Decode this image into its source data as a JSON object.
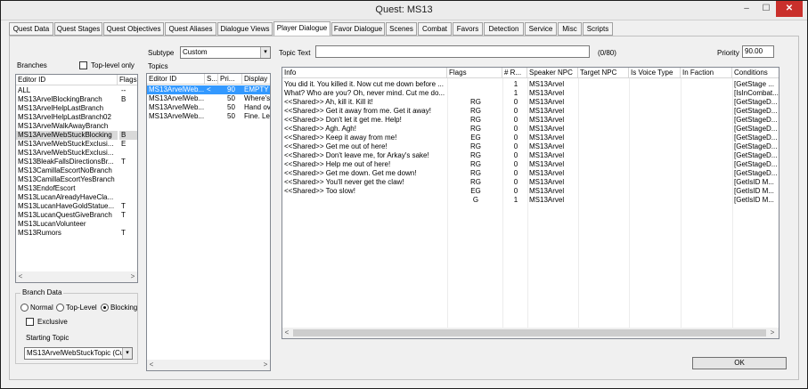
{
  "window": {
    "title": "Quest: MS13",
    "minimize": "–",
    "maximize": "☐",
    "close": "✕"
  },
  "tabs": [
    {
      "label": "Quest Data"
    },
    {
      "label": "Quest Stages"
    },
    {
      "label": "Quest Objectives"
    },
    {
      "label": "Quest Aliases"
    },
    {
      "label": "Dialogue Views"
    },
    {
      "label": "Player Dialogue"
    },
    {
      "label": "Favor Dialogue"
    },
    {
      "label": "Scenes"
    },
    {
      "label": "Combat"
    },
    {
      "label": "Favors"
    },
    {
      "label": "Detection"
    },
    {
      "label": "Service"
    },
    {
      "label": "Misc"
    },
    {
      "label": "Scripts"
    }
  ],
  "active_tab": "Player Dialogue",
  "branches": {
    "label": "Branches",
    "top_level_only_label": "Top-level only",
    "columns": [
      "Editor ID",
      "Flags"
    ],
    "rows": [
      {
        "id": "ALL",
        "flags": "--"
      },
      {
        "id": "MS13ArvelBlockingBranch",
        "flags": "B"
      },
      {
        "id": "MS13ArvelHelpLastBranch",
        "flags": ""
      },
      {
        "id": "MS13ArvelHelpLastBranch02",
        "flags": ""
      },
      {
        "id": "MS13ArvelWalkAwayBranch",
        "flags": ""
      },
      {
        "id": "MS13ArvelWebStuckBlocking",
        "flags": "B"
      },
      {
        "id": "MS13ArvelWebStuckExclusi...",
        "flags": "E"
      },
      {
        "id": "MS13ArvelWebStuckExclusi...",
        "flags": ""
      },
      {
        "id": "MS13BleakFallsDirectionsBr...",
        "flags": "T"
      },
      {
        "id": "MS13CamillaEscortNoBranch",
        "flags": ""
      },
      {
        "id": "MS13CamillaEscortYesBranch",
        "flags": ""
      },
      {
        "id": "MS13EndofEscort",
        "flags": ""
      },
      {
        "id": "MS13LucanAlreadyHaveCla...",
        "flags": ""
      },
      {
        "id": "MS13LucanHaveGoldStatue...",
        "flags": "T"
      },
      {
        "id": "MS13LucanQuestGiveBranch",
        "flags": "T"
      },
      {
        "id": "MS13LucanVolunteer",
        "flags": ""
      },
      {
        "id": "MS13Rumors",
        "flags": "T"
      }
    ]
  },
  "branch_data": {
    "title": "Branch Data",
    "radio_normal": "Normal",
    "radio_top_level": "Top-Level",
    "radio_blocking": "Blocking",
    "selected_radio": "Blocking",
    "exclusive_label": "Exclusive",
    "starting_topic_label": "Starting Topic",
    "starting_topic_value": "MS13ArvelWebStuckTopic (Cu"
  },
  "subtype": {
    "label": "Subtype",
    "value": "Custom"
  },
  "topics": {
    "label": "Topics",
    "columns": [
      "Editor ID",
      "S...",
      "Pri...",
      "Display"
    ],
    "rows": [
      {
        "id": "MS13ArvelWeb...",
        "s": "<",
        "pri": "90",
        "display": "EMPTY"
      },
      {
        "id": "MS13ArvelWeb...",
        "s": "",
        "pri": "50",
        "display": "Where's"
      },
      {
        "id": "MS13ArvelWeb...",
        "s": "",
        "pri": "50",
        "display": "Hand ov"
      },
      {
        "id": "MS13ArvelWeb...",
        "s": "",
        "pri": "50",
        "display": "Fine. Le"
      }
    ]
  },
  "topic_text": {
    "label": "Topic Text",
    "value": "",
    "counter": "(0/80)"
  },
  "priority": {
    "label": "Priority",
    "value": "90.00"
  },
  "info": {
    "columns": [
      "Info",
      "Flags",
      "# R...",
      "Speaker NPC",
      "Target NPC",
      "Is Voice Type",
      "In Faction",
      "Conditions"
    ],
    "rows": [
      {
        "info": "You did it. You killed it. Now cut me down before ...",
        "flags": "",
        "r": "1",
        "speaker": "MS13Arvel",
        "target": "",
        "voice": "",
        "faction": "",
        "cond": "[GetStage ..."
      },
      {
        "info": "What? Who are you? Oh, never mind. Cut me do...",
        "flags": "",
        "r": "1",
        "speaker": "MS13Arvel",
        "target": "",
        "voice": "",
        "faction": "",
        "cond": "[IsInCombat..."
      },
      {
        "info": "<<Shared>> Ah, kill it. Kill it!",
        "flags": "RG",
        "r": "0",
        "speaker": "MS13Arvel",
        "target": "",
        "voice": "",
        "faction": "",
        "cond": "[GetStageD..."
      },
      {
        "info": "<<Shared>> Get it away from me. Get it away!",
        "flags": "RG",
        "r": "0",
        "speaker": "MS13Arvel",
        "target": "",
        "voice": "",
        "faction": "",
        "cond": "[GetStageD..."
      },
      {
        "info": "<<Shared>> Don't let it get me. Help!",
        "flags": "RG",
        "r": "0",
        "speaker": "MS13Arvel",
        "target": "",
        "voice": "",
        "faction": "",
        "cond": "[GetStageD..."
      },
      {
        "info": "<<Shared>> Agh. Agh!",
        "flags": "RG",
        "r": "0",
        "speaker": "MS13Arvel",
        "target": "",
        "voice": "",
        "faction": "",
        "cond": "[GetStageD..."
      },
      {
        "info": "<<Shared>> Keep it away from me!",
        "flags": "EG",
        "r": "0",
        "speaker": "MS13Arvel",
        "target": "",
        "voice": "",
        "faction": "",
        "cond": "[GetStageD..."
      },
      {
        "info": "<<Shared>> Get me out of here!",
        "flags": "RG",
        "r": "0",
        "speaker": "MS13Arvel",
        "target": "",
        "voice": "",
        "faction": "",
        "cond": "[GetStageD..."
      },
      {
        "info": "<<Shared>> Don't leave me, for Arkay's sake!",
        "flags": "RG",
        "r": "0",
        "speaker": "MS13Arvel",
        "target": "",
        "voice": "",
        "faction": "",
        "cond": "[GetStageD..."
      },
      {
        "info": "<<Shared>> Help me out of here!",
        "flags": "RG",
        "r": "0",
        "speaker": "MS13Arvel",
        "target": "",
        "voice": "",
        "faction": "",
        "cond": "[GetStageD..."
      },
      {
        "info": "<<Shared>> Get me down. Get me down!",
        "flags": "RG",
        "r": "0",
        "speaker": "MS13Arvel",
        "target": "",
        "voice": "",
        "faction": "",
        "cond": "[GetStageD..."
      },
      {
        "info": "<<Shared>> You'll never get the claw!",
        "flags": "RG",
        "r": "0",
        "speaker": "MS13Arvel",
        "target": "",
        "voice": "",
        "faction": "",
        "cond": "[GetIsID M..."
      },
      {
        "info": "<<Shared>> Too slow!",
        "flags": "EG",
        "r": "0",
        "speaker": "MS13Arvel",
        "target": "",
        "voice": "",
        "faction": "",
        "cond": "[GetIsID M..."
      },
      {
        "info": "",
        "flags": "G",
        "r": "1",
        "speaker": "MS13Arvel",
        "target": "",
        "voice": "",
        "faction": "",
        "cond": "[GetIsID M..."
      }
    ]
  },
  "ok_label": "OK",
  "icons": {
    "dropdown": "▾",
    "scroll_left": "<",
    "scroll_right": ">"
  }
}
